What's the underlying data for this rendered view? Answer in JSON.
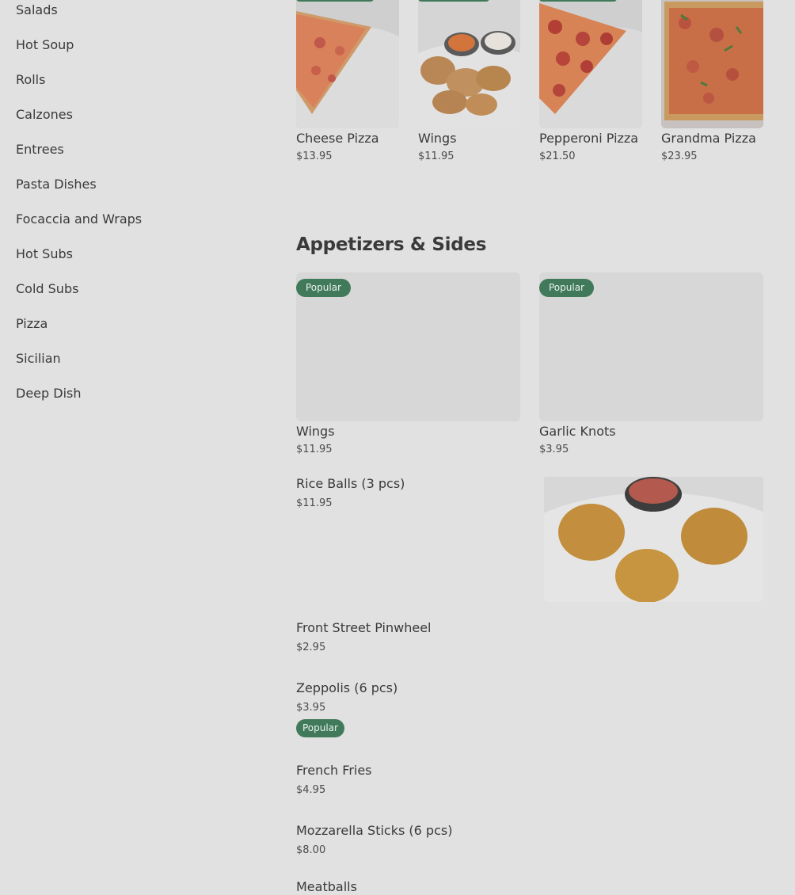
{
  "sidebar": {
    "items": [
      "Salads",
      "Hot Soup",
      "Rolls",
      "Calzones",
      "Entrees",
      "Pasta Dishes",
      "Focaccia and Wraps",
      "Hot Subs",
      "Cold Subs",
      "Pizza",
      "Sicilian",
      "Deep Dish"
    ]
  },
  "featured": [
    {
      "name": "Cheese Pizza",
      "price": "$13.95",
      "icon": "cheese-pizza-image"
    },
    {
      "name": "Wings",
      "price": "$11.95",
      "icon": "wings-image"
    },
    {
      "name": "Pepperoni Pizza",
      "price": "$21.50",
      "icon": "pepperoni-pizza-image"
    },
    {
      "name": "Grandma Pizza",
      "price": "$23.95",
      "icon": "grandma-pizza-image"
    }
  ],
  "section": {
    "title": "Appetizers & Sides",
    "cards": [
      {
        "badge": "Popular",
        "name": "Wings",
        "price": "$11.95"
      },
      {
        "badge": "Popular",
        "name": "Garlic Knots",
        "price": "$3.95"
      }
    ],
    "items": [
      {
        "name": "Rice Balls (3 pcs)",
        "price": "$11.95"
      },
      {
        "name": "Front Street Pinwheel",
        "price": "$2.95"
      },
      {
        "name": "Zeppolis (6 pcs)",
        "price": "$3.95",
        "badge": "Popular"
      },
      {
        "name": "French Fries",
        "price": "$4.95"
      },
      {
        "name": "Mozzarella Sticks (6 pcs)",
        "price": "$8.00"
      },
      {
        "name": "Meatballs"
      }
    ]
  },
  "colors": {
    "badge": "#417a5b",
    "background": "#e1e1e1"
  }
}
